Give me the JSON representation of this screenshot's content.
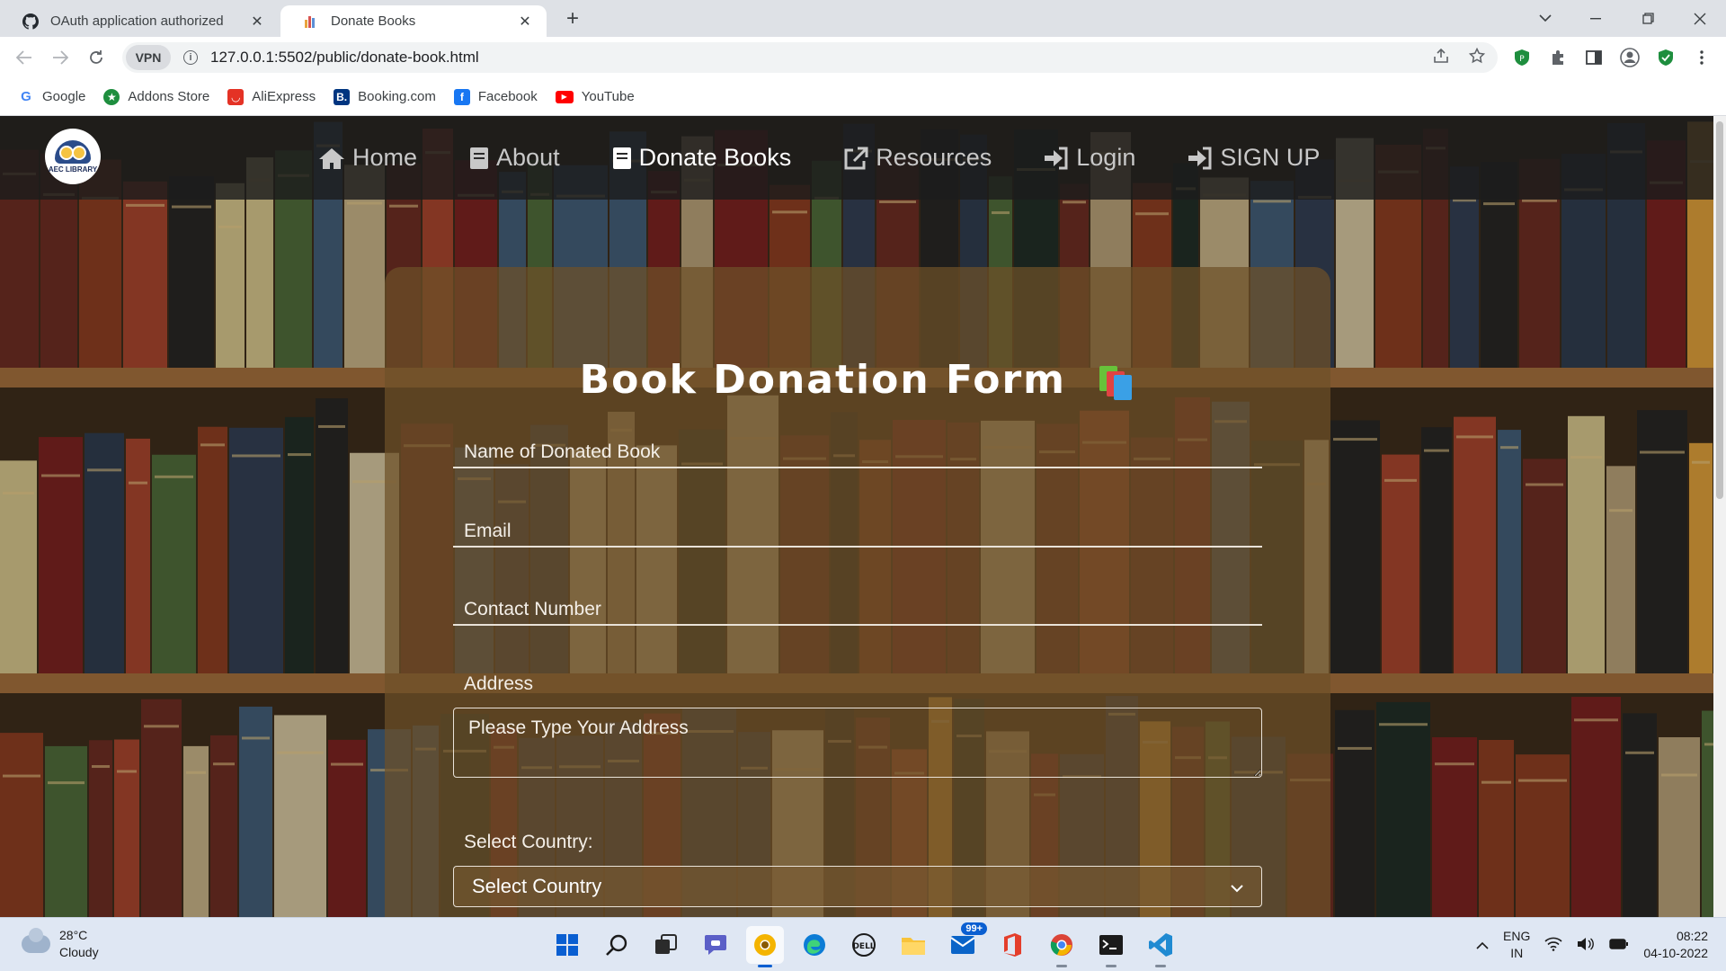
{
  "browser": {
    "tabs": [
      {
        "title": "OAuth application authorized",
        "active": false,
        "icon": "github-icon"
      },
      {
        "title": "Donate Books",
        "active": true,
        "icon": "site-favicon"
      }
    ],
    "vpn_label": "VPN",
    "url": "127.0.0.1:5502/public/donate-book.html",
    "bookmarks": [
      {
        "label": "Google",
        "icon": "google-icon",
        "color": "#4285f4"
      },
      {
        "label": "Addons Store",
        "icon": "addons-store-icon",
        "color": "#1e8e3e"
      },
      {
        "label": "AliExpress",
        "icon": "aliexpress-icon",
        "color": "#e43225"
      },
      {
        "label": "Booking.com",
        "icon": "booking-icon",
        "color": "#003580"
      },
      {
        "label": "Facebook",
        "icon": "facebook-icon",
        "color": "#1877f2"
      },
      {
        "label": "YouTube",
        "icon": "youtube-icon",
        "color": "#ff0000"
      }
    ]
  },
  "site": {
    "logo_text": "AEC LIBRARY",
    "nav": [
      {
        "label": "Home",
        "icon": "home-icon",
        "active": false
      },
      {
        "label": "About",
        "icon": "book-icon",
        "active": false
      },
      {
        "label": "Donate Books",
        "icon": "book-icon",
        "active": true
      },
      {
        "label": "Resources",
        "icon": "external-link-icon",
        "active": false
      },
      {
        "label": "Login",
        "icon": "sign-in-icon",
        "active": false
      },
      {
        "label": "SIGN UP",
        "icon": "sign-in-icon",
        "active": false
      }
    ]
  },
  "form": {
    "title": "Book Donation Form",
    "book_name_placeholder": "Name of Donated Book",
    "email_placeholder": "Email",
    "contact_placeholder": "Contact Number",
    "address_label": "Address",
    "address_placeholder": "Please Type Your Address",
    "country_label": "Select Country:",
    "country_selected": "Select Country"
  },
  "taskbar": {
    "weather_temp": "28°C",
    "weather_desc": "Cloudy",
    "mail_badge": "99+",
    "lang_top": "ENG",
    "lang_bottom": "IN",
    "time": "08:22",
    "date": "04-10-2022"
  },
  "colors": {
    "nav_bg": "#1c1c1c",
    "card_bg": "#6e5028",
    "accent_blue": "#0a5fd1"
  }
}
